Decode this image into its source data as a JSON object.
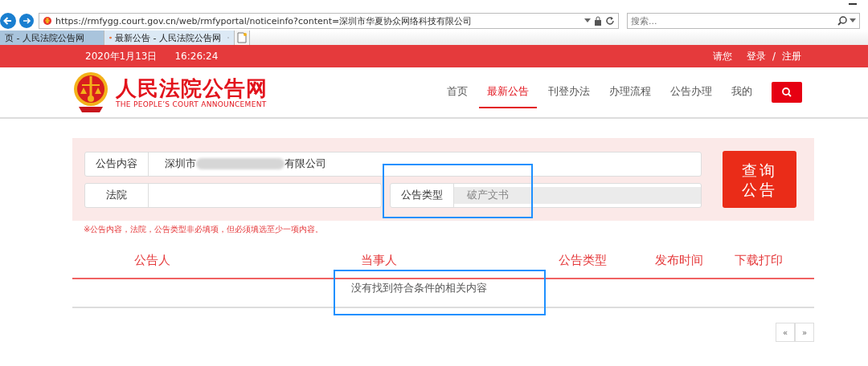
{
  "browser": {
    "url": "https://rmfygg.court.gov.cn/web/rmfyportal/noticeinfo?content=深圳市华夏协众网络科技有限公司",
    "search_placeholder": "搜索...",
    "tabs": [
      {
        "label": "页 - 人民法院公告网",
        "selected": false
      },
      {
        "label": "最新公告 - 人民法院公告网",
        "selected": true
      }
    ]
  },
  "top_bar": {
    "date": "2020年1月13日",
    "time": "16:26:24",
    "greeting": "请您",
    "login": "登录",
    "separator": "/",
    "register": "注册"
  },
  "header": {
    "logo_title": "人民法院公告网",
    "logo_subtitle": "THE PEOPLE’S COURT ANNOUNCEMENT",
    "nav": [
      {
        "label": "首页",
        "selected": false
      },
      {
        "label": "最新公告",
        "selected": true
      },
      {
        "label": "刊登办法",
        "selected": false
      },
      {
        "label": "办理流程",
        "selected": false
      },
      {
        "label": "公告办理",
        "selected": false
      },
      {
        "label": "我的",
        "selected": false
      }
    ]
  },
  "search_form": {
    "content_label": "公告内容",
    "content_value_start": "深圳市",
    "content_value_end": "有限公司",
    "court_label": "法院",
    "type_label": "公告类型",
    "type_value": "破产文书",
    "submit": "查询公告",
    "note": "※公告内容，法院，公告类型非必填项，但必须填选至少一项内容。"
  },
  "results": {
    "columns": [
      "公告人",
      "当事人",
      "公告类型",
      "发布时间",
      "下载打印"
    ],
    "empty_message": "没有找到符合条件的相关内容",
    "pager": [
      "«",
      "»"
    ]
  },
  "highlights": {
    "type_field": true,
    "empty_message": true
  }
}
